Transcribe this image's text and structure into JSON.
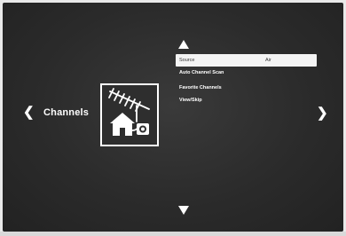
{
  "page": {
    "title": "Channels"
  },
  "nav": {
    "left_glyph": "❮",
    "right_glyph": "❯"
  },
  "icon": {
    "name": "antenna-house-icon"
  },
  "menu": {
    "items": [
      {
        "label": "Source",
        "value": "Air",
        "selected": true
      },
      {
        "label": "Auto Channel Scan",
        "value": "",
        "selected": false
      },
      {
        "label": "Favorite Channels",
        "value": "",
        "selected": false
      },
      {
        "label": "View/Skip",
        "value": "",
        "selected": false
      }
    ]
  },
  "colors": {
    "background": "#2b2b2b",
    "text": "#ffffff",
    "highlight": "#f4f4f4",
    "highlight_text": "#333333"
  }
}
